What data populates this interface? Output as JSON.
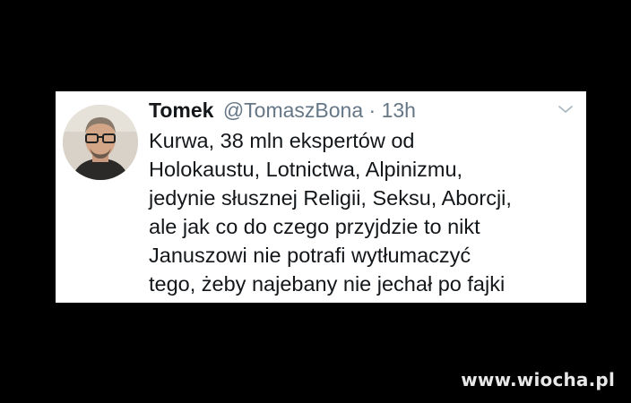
{
  "tweet": {
    "display_name": "Tomek",
    "handle": "@TomaszBona",
    "separator": "·",
    "time": "13h",
    "avatar_icon": "avatar-photo",
    "menu_icon": "chevron-down-icon",
    "lines": [
      "Kurwa, 38 mln ekspertów od",
      "Holokaustu, Lotnictwa, Alpinizmu,",
      "jedynie słusznej Religii, Seksu, Aborcji,",
      "ale jak co do czego przyjdzie to nikt",
      "Januszowi nie potrafi wytłumaczyć",
      "tego, żeby najebany nie jechał po fajki"
    ]
  },
  "watermark": "www.wiocha.pl",
  "colors": {
    "background": "#000000",
    "card": "#ffffff",
    "text": "#14171a",
    "secondary": "#657786"
  }
}
